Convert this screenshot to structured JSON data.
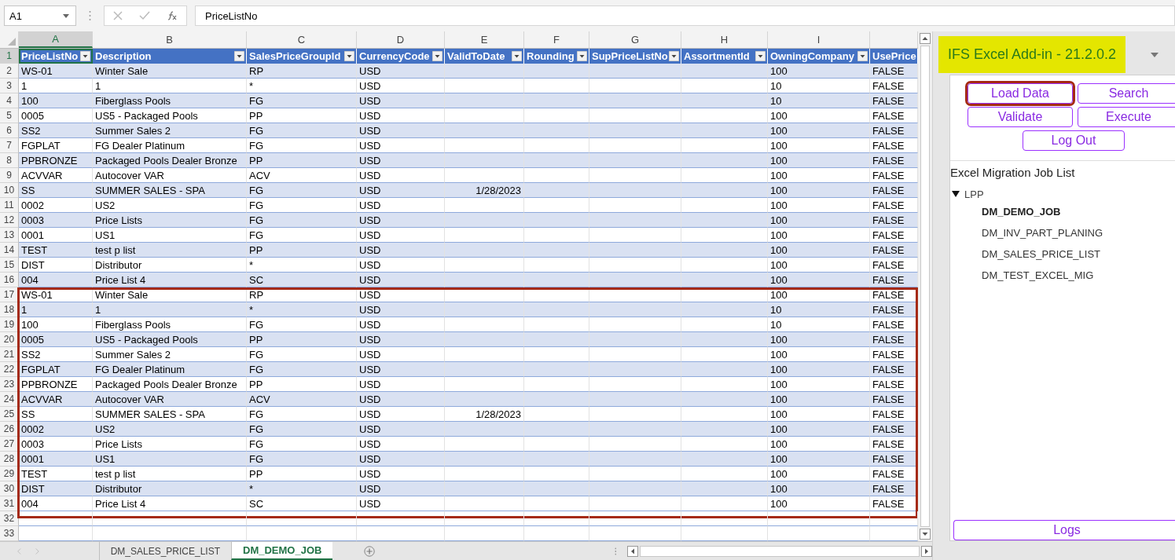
{
  "formula_bar": {
    "name_box": "A1",
    "formula": "PriceListNo"
  },
  "column_letters": [
    {
      "label": "A",
      "selected": true
    },
    {
      "label": "B",
      "selected": false
    },
    {
      "label": "C",
      "selected": false
    },
    {
      "label": "D",
      "selected": false
    },
    {
      "label": "E",
      "selected": false
    },
    {
      "label": "F",
      "selected": false
    },
    {
      "label": "G",
      "selected": false
    },
    {
      "label": "H",
      "selected": false
    },
    {
      "label": "I",
      "selected": false
    }
  ],
  "row_numbers": [
    {
      "label": "1",
      "selected": true
    },
    {
      "label": "2",
      "selected": false
    },
    {
      "label": "3",
      "selected": false
    },
    {
      "label": "4",
      "selected": false
    },
    {
      "label": "5",
      "selected": false
    },
    {
      "label": "6",
      "selected": false
    },
    {
      "label": "7",
      "selected": false
    },
    {
      "label": "8",
      "selected": false
    },
    {
      "label": "9",
      "selected": false
    },
    {
      "label": "10",
      "selected": false
    },
    {
      "label": "11",
      "selected": false
    },
    {
      "label": "12",
      "selected": false
    },
    {
      "label": "13",
      "selected": false
    },
    {
      "label": "14",
      "selected": false
    },
    {
      "label": "15",
      "selected": false
    },
    {
      "label": "16",
      "selected": false
    },
    {
      "label": "17",
      "selected": false
    },
    {
      "label": "18",
      "selected": false
    },
    {
      "label": "19",
      "selected": false
    },
    {
      "label": "20",
      "selected": false
    },
    {
      "label": "21",
      "selected": false
    },
    {
      "label": "22",
      "selected": false
    },
    {
      "label": "23",
      "selected": false
    },
    {
      "label": "24",
      "selected": false
    },
    {
      "label": "25",
      "selected": false
    },
    {
      "label": "26",
      "selected": false
    },
    {
      "label": "27",
      "selected": false
    },
    {
      "label": "28",
      "selected": false
    },
    {
      "label": "29",
      "selected": false
    },
    {
      "label": "30",
      "selected": false
    },
    {
      "label": "31",
      "selected": false
    },
    {
      "label": "32",
      "selected": false
    },
    {
      "label": "33",
      "selected": false
    }
  ],
  "table": {
    "columns": [
      {
        "label": "PriceListNo",
        "kind": "text",
        "filter": true,
        "selected": true
      },
      {
        "label": "Description",
        "kind": "text",
        "filter": true,
        "selected": false
      },
      {
        "label": "SalesPriceGroupId",
        "kind": "text",
        "filter": true,
        "selected": false
      },
      {
        "label": "CurrencyCode",
        "kind": "text",
        "filter": true,
        "selected": false
      },
      {
        "label": "ValidToDate",
        "kind": "date",
        "filter": true,
        "selected": false
      },
      {
        "label": "Rounding",
        "kind": "text",
        "filter": true,
        "selected": false
      },
      {
        "label": "SupPriceListNo",
        "kind": "text",
        "filter": true,
        "selected": false
      },
      {
        "label": "AssortmentId",
        "kind": "text",
        "filter": true,
        "selected": false
      },
      {
        "label": "OwningCompany",
        "kind": "text",
        "filter": true,
        "selected": false
      },
      {
        "label": "UsePrice",
        "kind": "text",
        "filter": false,
        "selected": false
      }
    ],
    "rows": [
      [
        "WS-01",
        "Winter Sale",
        "RP",
        "USD",
        null,
        null,
        null,
        null,
        "100",
        "FALSE"
      ],
      [
        "1",
        "1",
        "*",
        "USD",
        null,
        null,
        null,
        null,
        "10",
        "FALSE"
      ],
      [
        "100",
        "Fiberglass Pools",
        "FG",
        "USD",
        null,
        null,
        null,
        null,
        "10",
        "FALSE"
      ],
      [
        "0005",
        "US5 - Packaged Pools",
        "PP",
        "USD",
        null,
        null,
        null,
        null,
        "100",
        "FALSE"
      ],
      [
        "SS2",
        "Summer Sales 2",
        "FG",
        "USD",
        null,
        null,
        null,
        null,
        "100",
        "FALSE"
      ],
      [
        "FGPLAT",
        "FG Dealer Platinum",
        "FG",
        "USD",
        null,
        null,
        null,
        null,
        "100",
        "FALSE"
      ],
      [
        "PPBRONZE",
        "Packaged Pools Dealer Bronze",
        "PP",
        "USD",
        null,
        null,
        null,
        null,
        "100",
        "FALSE"
      ],
      [
        "ACVVAR",
        "Autocover VAR",
        "ACV",
        "USD",
        null,
        null,
        null,
        null,
        "100",
        "FALSE"
      ],
      [
        "SS",
        "SUMMER SALES - SPA",
        "FG",
        "USD",
        "1/28/2023",
        null,
        null,
        null,
        "100",
        "FALSE"
      ],
      [
        "0002",
        "US2",
        "FG",
        "USD",
        null,
        null,
        null,
        null,
        "100",
        "FALSE"
      ],
      [
        "0003",
        "Price Lists",
        "FG",
        "USD",
        null,
        null,
        null,
        null,
        "100",
        "FALSE"
      ],
      [
        "0001",
        "US1",
        "FG",
        "USD",
        null,
        null,
        null,
        null,
        "100",
        "FALSE"
      ],
      [
        "TEST",
        "test p list",
        "PP",
        "USD",
        null,
        null,
        null,
        null,
        "100",
        "FALSE"
      ],
      [
        "DIST",
        "Distributor",
        "*",
        "USD",
        null,
        null,
        null,
        null,
        "100",
        "FALSE"
      ],
      [
        "004",
        "Price List 4",
        "SC",
        "USD",
        null,
        null,
        null,
        null,
        "100",
        "FALSE"
      ]
    ],
    "framed_rows": [
      [
        "WS-01",
        "Winter Sale",
        "RP",
        "USD",
        null,
        null,
        null,
        null,
        "100",
        "FALSE"
      ],
      [
        "1",
        "1",
        "*",
        "USD",
        null,
        null,
        null,
        null,
        "10",
        "FALSE"
      ],
      [
        "100",
        "Fiberglass Pools",
        "FG",
        "USD",
        null,
        null,
        null,
        null,
        "10",
        "FALSE"
      ],
      [
        "0005",
        "US5 - Packaged Pools",
        "PP",
        "USD",
        null,
        null,
        null,
        null,
        "100",
        "FALSE"
      ],
      [
        "SS2",
        "Summer Sales 2",
        "FG",
        "USD",
        null,
        null,
        null,
        null,
        "100",
        "FALSE"
      ],
      [
        "FGPLAT",
        "FG Dealer Platinum",
        "FG",
        "USD",
        null,
        null,
        null,
        null,
        "100",
        "FALSE"
      ],
      [
        "PPBRONZE",
        "Packaged Pools Dealer Bronze",
        "PP",
        "USD",
        null,
        null,
        null,
        null,
        "100",
        "FALSE"
      ],
      [
        "ACVVAR",
        "Autocover VAR",
        "ACV",
        "USD",
        null,
        null,
        null,
        null,
        "100",
        "FALSE"
      ],
      [
        "SS",
        "SUMMER SALES - SPA",
        "FG",
        "USD",
        "1/28/2023",
        null,
        null,
        null,
        "100",
        "FALSE"
      ],
      [
        "0002",
        "US2",
        "FG",
        "USD",
        null,
        null,
        null,
        null,
        "100",
        "FALSE"
      ],
      [
        "0003",
        "Price Lists",
        "FG",
        "USD",
        null,
        null,
        null,
        null,
        "100",
        "FALSE"
      ],
      [
        "0001",
        "US1",
        "FG",
        "USD",
        null,
        null,
        null,
        null,
        "100",
        "FALSE"
      ],
      [
        "TEST",
        "test p list",
        "PP",
        "USD",
        null,
        null,
        null,
        null,
        "100",
        "FALSE"
      ],
      [
        "DIST",
        "Distributor",
        "*",
        "USD",
        null,
        null,
        null,
        null,
        "100",
        "FALSE"
      ],
      [
        "004",
        "Price List 4",
        "SC",
        "USD",
        null,
        null,
        null,
        null,
        "100",
        "FALSE"
      ]
    ]
  },
  "sheet_tabs": [
    {
      "label": "DM_SALES_PRICE_LIST",
      "selected": false
    },
    {
      "label": "DM_DEMO_JOB",
      "selected": true
    }
  ],
  "addin_pane": {
    "title": "IFS Excel Add-in - 21.2.0.2",
    "buttons": [
      {
        "label": "Load Data",
        "highlighted": true
      },
      {
        "label": "Search",
        "highlighted": false
      },
      {
        "label": "Validate",
        "highlighted": false
      },
      {
        "label": "Execute",
        "highlighted": false
      },
      {
        "label": "Log Out",
        "highlighted": false
      }
    ],
    "job_list_title": "Excel Migration Job List",
    "tree": [
      {
        "label": "LPP",
        "expanded": true,
        "children": [
          {
            "label": "DM_DEMO_JOB",
            "selected": true
          },
          {
            "label": "DM_INV_PART_PLANING",
            "selected": false
          },
          {
            "label": "DM_SALES_PRICE_LIST",
            "selected": false
          },
          {
            "label": "DM_TEST_EXCEL_MIG",
            "selected": false
          }
        ]
      }
    ],
    "logs_button": "Logs"
  }
}
